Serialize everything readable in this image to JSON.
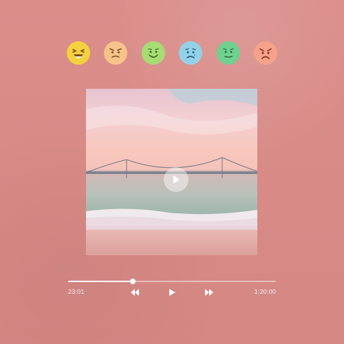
{
  "mood_emojis": [
    {
      "name": "laughing-face-icon",
      "color": "#f4d23f"
    },
    {
      "name": "annoyed-face-icon",
      "color": "#f7c38b"
    },
    {
      "name": "smiling-face-icon",
      "color": "#a7dc73"
    },
    {
      "name": "sad-face-icon",
      "color": "#92d1e8"
    },
    {
      "name": "calm-face-icon",
      "color": "#6fd08f"
    },
    {
      "name": "angry-face-icon",
      "color": "#f6a28a"
    }
  ],
  "album": {
    "icon": "bridge-sunset-artwork",
    "sky_top": "#f3d0d6",
    "sky_mid": "#f8c9c2",
    "sea": "#b9c4bd",
    "foam": "#f6eef2",
    "sand": "#e2a7a1"
  },
  "player": {
    "progress": 0.31,
    "elapsed": "23:01",
    "duration": "1:20:00",
    "controls": {
      "rewind_icon": "rewind-icon",
      "play_icon": "play-icon",
      "forward_icon": "fast-forward-icon"
    }
  },
  "colors": {
    "background": "#d98a86",
    "accent": "#ffffff"
  }
}
